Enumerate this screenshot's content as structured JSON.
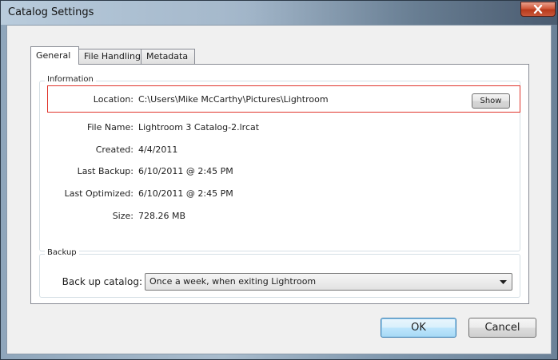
{
  "window": {
    "title": "Catalog Settings"
  },
  "tabs": [
    {
      "label": "General",
      "active": true
    },
    {
      "label": "File Handling",
      "active": false
    },
    {
      "label": "Metadata",
      "active": false
    }
  ],
  "information": {
    "caption": "Information",
    "location_label": "Location:",
    "location_value": "C:\\Users\\Mike McCarthy\\Pictures\\Lightroom",
    "show_label": "Show",
    "file_name_label": "File Name:",
    "file_name_value": "Lightroom 3 Catalog-2.lrcat",
    "created_label": "Created:",
    "created_value": "4/4/2011",
    "last_backup_label": "Last Backup:",
    "last_backup_value": "6/10/2011 @ 2:45 PM",
    "last_optimized_label": "Last Optimized:",
    "last_optimized_value": "6/10/2011 @ 2:45 PM",
    "size_label": "Size:",
    "size_value": "728.26 MB"
  },
  "backup": {
    "caption": "Backup",
    "backup_label": "Back up catalog:",
    "backup_value": "Once a week, when exiting Lightroom"
  },
  "buttons": {
    "ok": "OK",
    "cancel": "Cancel"
  },
  "colors": {
    "highlight": "#e0342c",
    "close_button": "#c9573a",
    "default_button_border": "#3c7fb1"
  },
  "icons": {
    "close": "close-icon",
    "dropdown": "chevron-down-icon"
  }
}
